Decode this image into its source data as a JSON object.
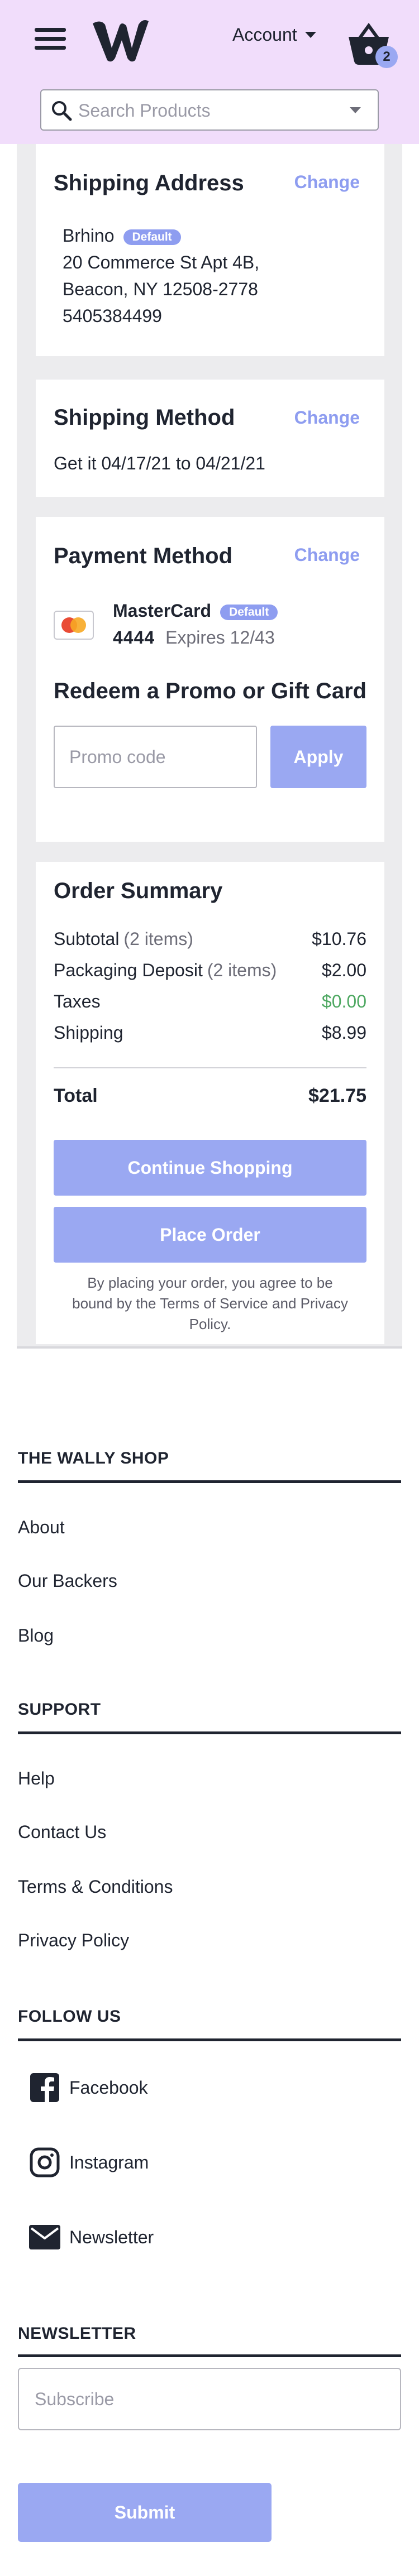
{
  "header": {
    "account_label": "Account",
    "cart_count": "2",
    "search_placeholder": "Search Products"
  },
  "shipping_address": {
    "title": "Shipping Address",
    "change_label": "Change",
    "name": "Brhino",
    "default_badge": "Default",
    "line1": "20 Commerce St Apt 4B,",
    "line2": "Beacon, NY 12508-2778",
    "phone": "5405384499"
  },
  "shipping_method": {
    "title": "Shipping Method",
    "change_label": "Change",
    "estimate": "Get it 04/17/21 to 04/21/21"
  },
  "payment_method": {
    "title": "Payment Method",
    "change_label": "Change",
    "card_brand": "MasterCard",
    "default_badge": "Default",
    "last4": "4444",
    "expires": "Expires 12/43",
    "promo_title": "Redeem a Promo or Gift Card",
    "promo_placeholder": "Promo code",
    "apply_label": "Apply"
  },
  "order_summary": {
    "title": "Order Summary",
    "rows": [
      {
        "label": "Subtotal",
        "note": "(2 items)",
        "value": "$10.76"
      },
      {
        "label": "Packaging Deposit",
        "note": "(2 items)",
        "value": "$2.00"
      },
      {
        "label": "Taxes",
        "note": "",
        "value": "$0.00"
      },
      {
        "label": "Shipping",
        "note": "",
        "value": "$8.99"
      }
    ],
    "total_label": "Total",
    "total_value": "$21.75",
    "continue_label": "Continue Shopping",
    "place_order_label": "Place Order",
    "disclaimer": "By placing your order, you agree to be bound by the Terms of Service and Privacy Policy."
  },
  "footer": {
    "shop_title": "THE WALLY SHOP",
    "shop_links": [
      "About",
      "Our Backers",
      "Blog"
    ],
    "support_title": "SUPPORT",
    "support_links": [
      "Help",
      "Contact Us",
      "Terms & Conditions",
      "Privacy Policy"
    ],
    "follow_title": "FOLLOW US",
    "social": [
      {
        "label": "Facebook",
        "icon": "facebook-icon"
      },
      {
        "label": "Instagram",
        "icon": "instagram-icon"
      },
      {
        "label": "Newsletter",
        "icon": "mail-icon"
      }
    ],
    "newsletter_title": "NEWSLETTER",
    "subscribe_placeholder": "Subscribe",
    "submit_label": "Submit"
  },
  "colors": {
    "header_bg": "#f1ddfb",
    "accent": "#9aa8f2",
    "text": "#1f2430",
    "success": "#4ea862"
  }
}
